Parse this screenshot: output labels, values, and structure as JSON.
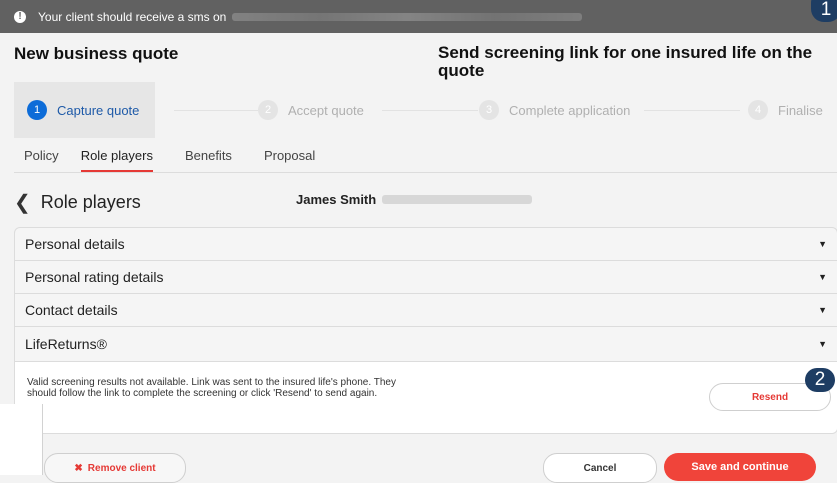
{
  "toast": {
    "message": "Your client should receive a sms on",
    "icon": "info-icon"
  },
  "callouts": [
    "1",
    "2"
  ],
  "header": {
    "title": "New business quote",
    "subtitle": "Send screening link for one insured life on the quote"
  },
  "stepper": [
    {
      "num": "1",
      "label": "Capture quote",
      "active": true
    },
    {
      "num": "2",
      "label": "Accept quote",
      "active": false
    },
    {
      "num": "3",
      "label": "Complete application",
      "active": false
    },
    {
      "num": "4",
      "label": "Finalise",
      "active": false
    }
  ],
  "tabs": [
    "Policy",
    "Role players",
    "Benefits",
    "Proposal"
  ],
  "active_tab": "Role players",
  "section": {
    "back_icon": "chevron-left-icon",
    "title": "Role players",
    "person_name": "James Smith"
  },
  "accordion": [
    {
      "label": "Personal details"
    },
    {
      "label": "Personal rating details"
    },
    {
      "label": "Contact details"
    },
    {
      "label": "LifeReturns®"
    }
  ],
  "panel": {
    "note": "Valid screening results not available. Link was sent to the insured life's phone. They should follow the link to complete the screening or click 'Resend' to send again.",
    "resend_label": "Resend"
  },
  "footer": {
    "remove_label": "Remove client",
    "cancel_label": "Cancel",
    "save_label": "Save and continue"
  },
  "colors": {
    "accent": "#e53935",
    "primary": "#0d6cd8",
    "callout": "#1e3d63"
  }
}
